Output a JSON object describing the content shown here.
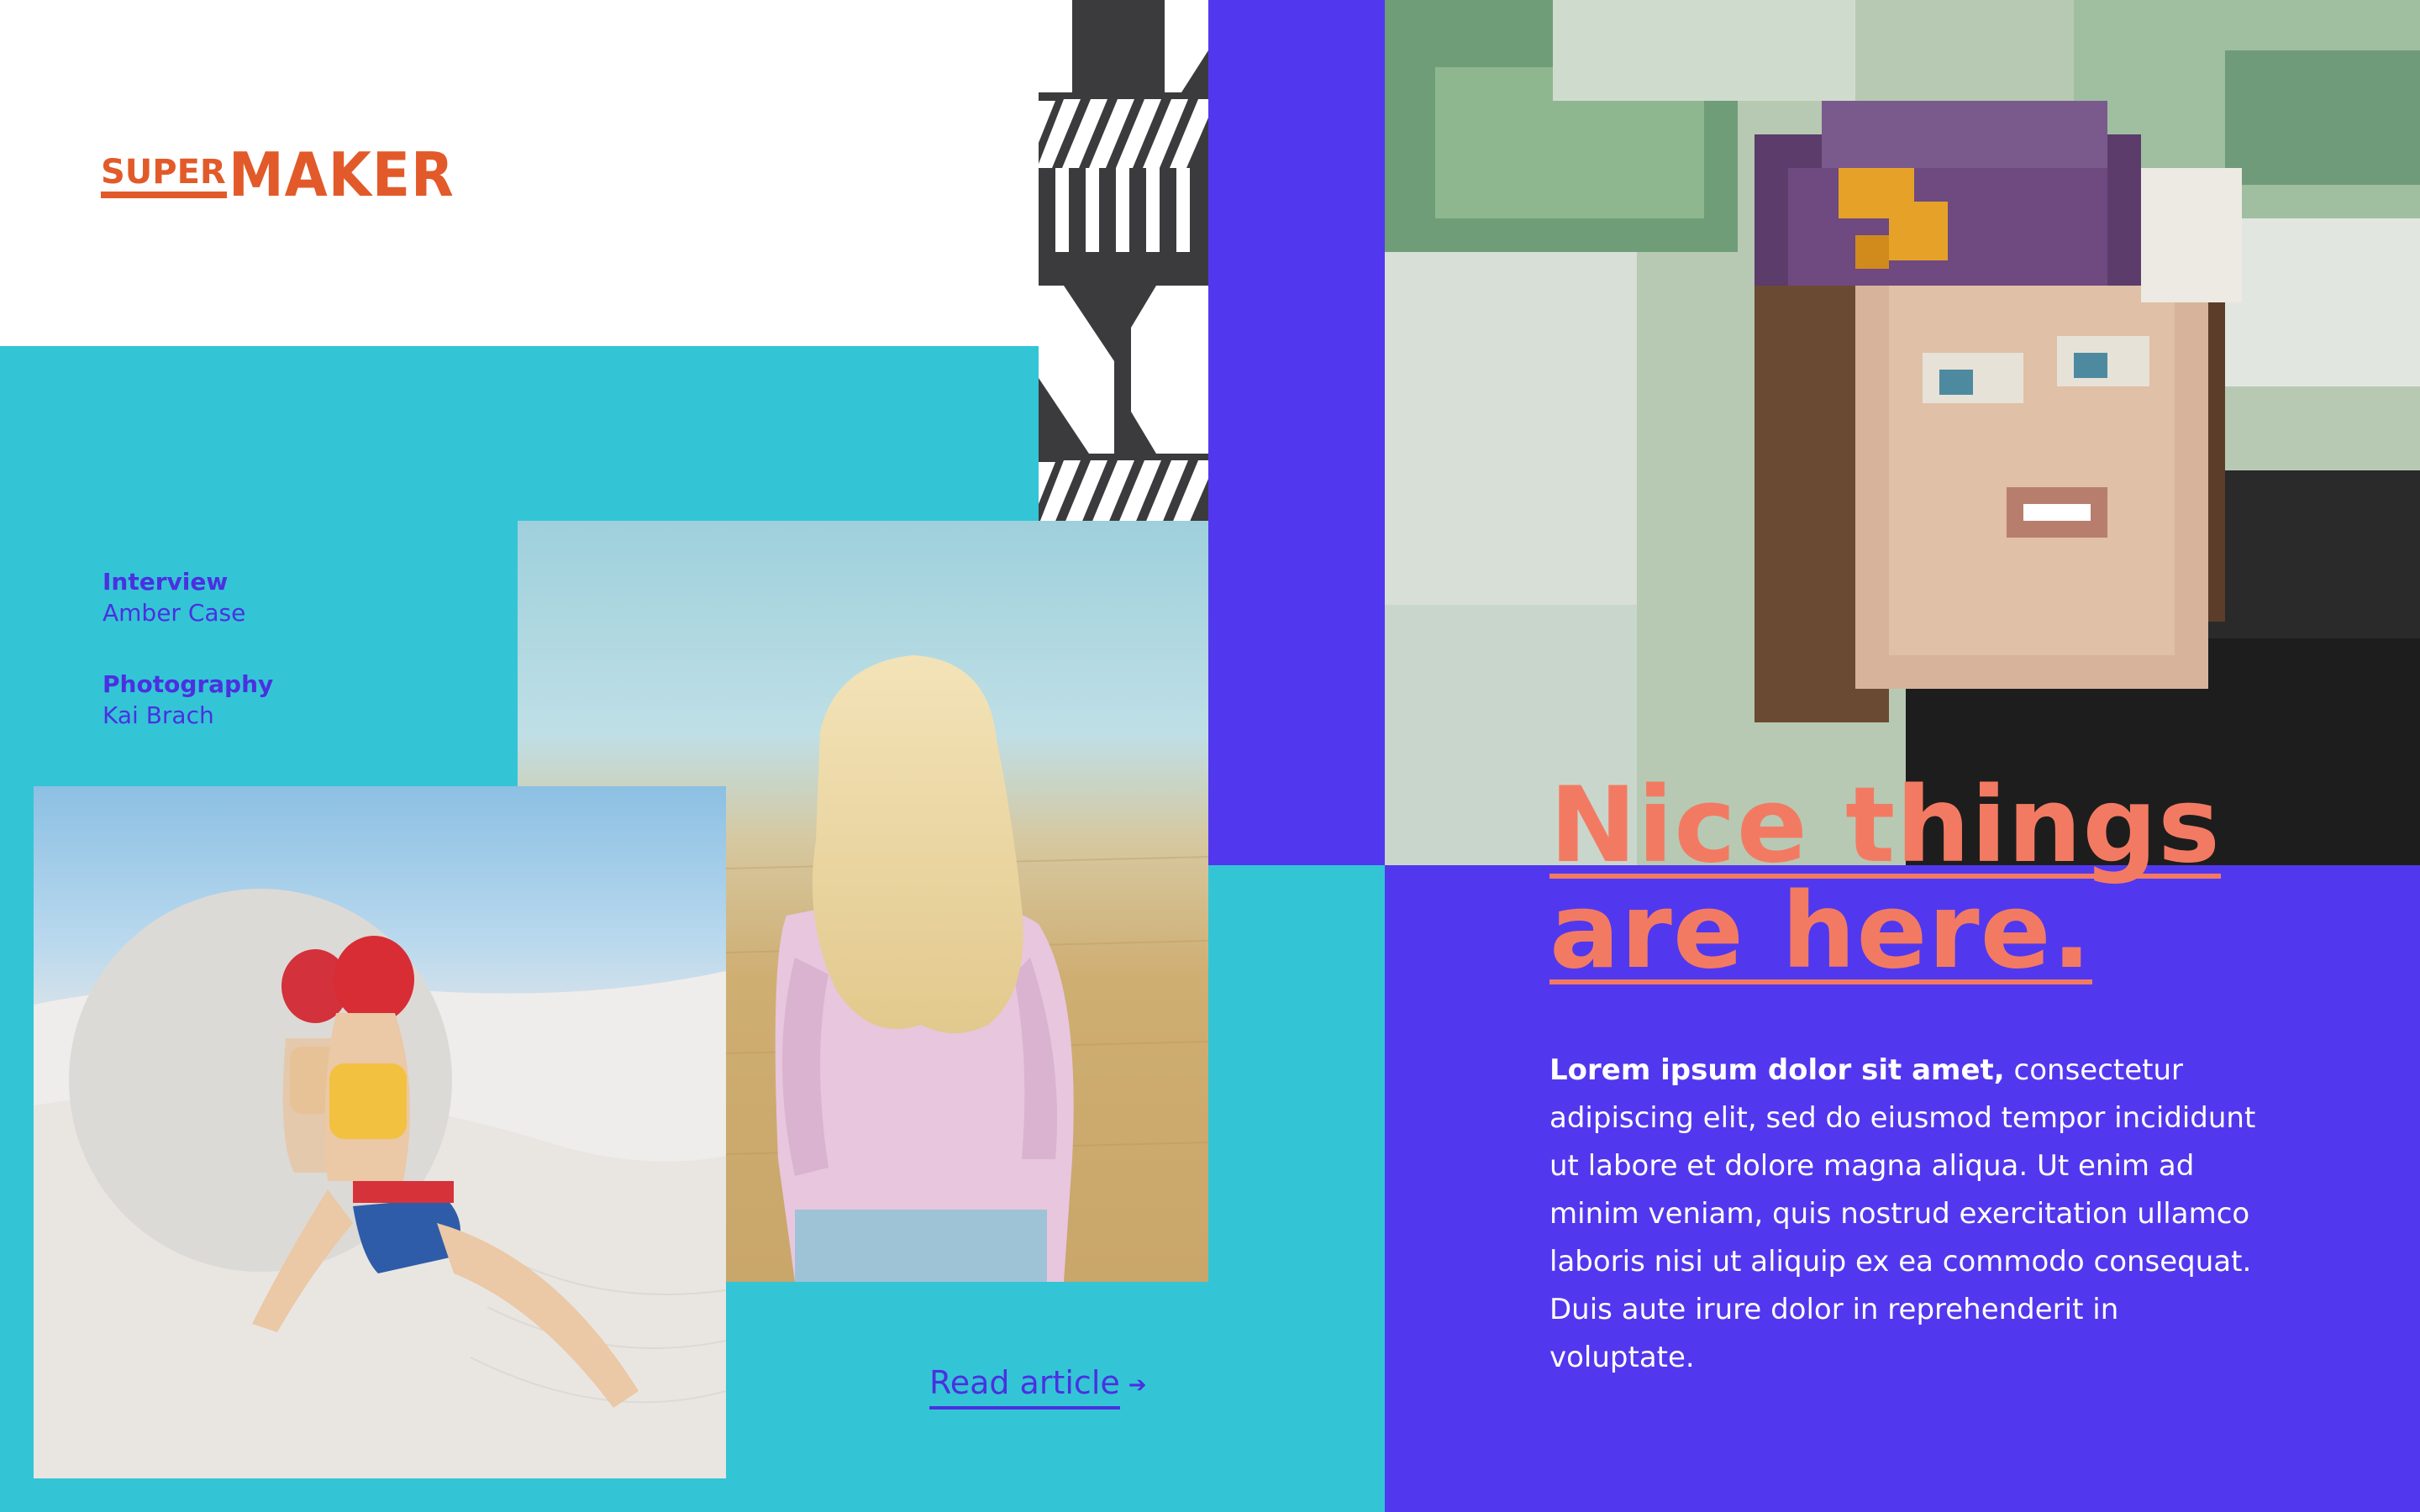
{
  "brand": {
    "logo_super": "SUPER",
    "logo_maker": "MAKER",
    "color": "#E25A2A"
  },
  "credits": {
    "interview_label": "Interview",
    "interview_name": "Amber Case",
    "photography_label": "Photography",
    "photography_name": "Kai Brach"
  },
  "headline": {
    "line1": "Nice things",
    "line2": "are here."
  },
  "body": {
    "lead": "Lorem ipsum dolor sit amet,",
    "rest": " consectetur adipiscing elit, sed do eiusmod tempor incididunt ut labore et dolore magna aliqua. Ut enim ad minim veniam, quis nostrud exercitation ullamco laboris nisi ut aliquip ex ea commodo consequat. Duis aute irure dolor in reprehenderit in voluptate."
  },
  "cta": {
    "label": "Read article",
    "arrow": "➔"
  },
  "colors": {
    "cyan": "#33C5D6",
    "purple": "#5138EE",
    "coral": "#F37A62",
    "link": "#4B30E0"
  },
  "icons": {
    "cta_arrow": "arrow-right-icon"
  }
}
